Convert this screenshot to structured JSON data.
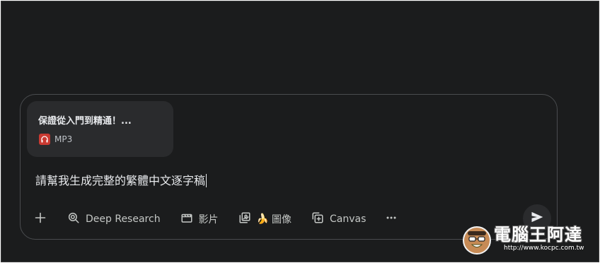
{
  "attachment": {
    "title": "保證從入門到精通！...",
    "file_type": "MP3",
    "icon": "headphones-icon",
    "icon_color": "#c93a32"
  },
  "prompt": {
    "text": "請幫我生成完整的繁體中文逐字稿"
  },
  "toolbar": {
    "add_icon": "plus-icon",
    "tools": [
      {
        "label": "Deep Research",
        "icon": "deep-research-icon"
      },
      {
        "label": "影片",
        "icon": "clapperboard-icon"
      },
      {
        "label": "圖像",
        "icon": "image-gallery-icon",
        "emoji": "🍌"
      },
      {
        "label": "Canvas",
        "icon": "canvas-icon"
      }
    ],
    "more_icon": "more-horizontal-icon"
  },
  "send_icon": "send-icon",
  "watermark": {
    "title": "電腦王阿達",
    "url": "http://www.kocpc.com.tw"
  },
  "colors": {
    "background": "#1b1c1d",
    "border": "#4a4c4f",
    "chip": "#2a2b2d",
    "text": "#e8eaed",
    "muted": "#c4c7c5"
  }
}
